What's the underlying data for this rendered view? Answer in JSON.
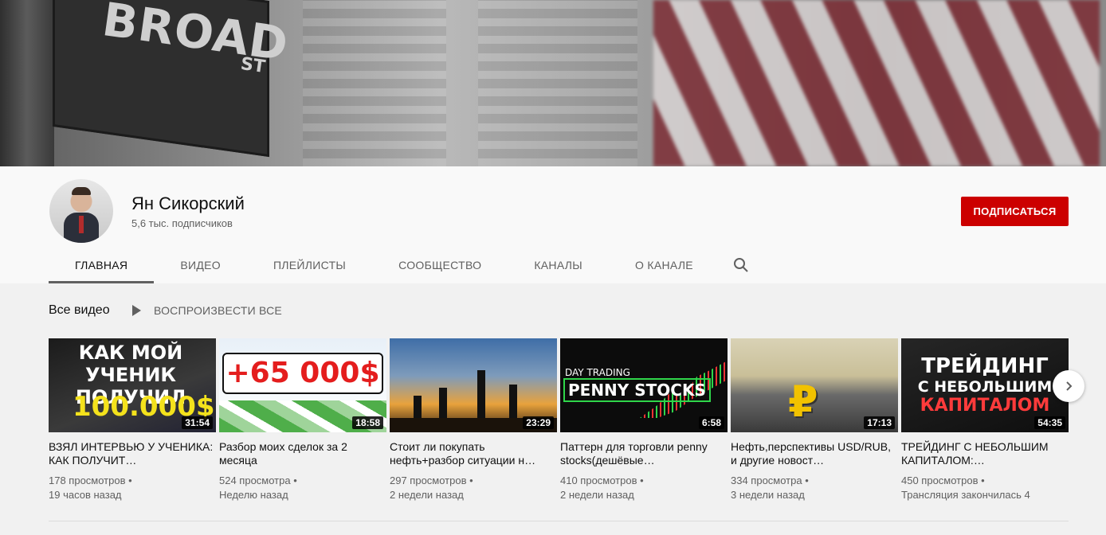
{
  "banner": {
    "sign_text": "BROAD",
    "sign_suffix": "ST"
  },
  "channel": {
    "name": "Ян Сикорский",
    "subscribers": "5,6 тыс. подписчиков",
    "subscribe_label": "ПОДПИСАТЬСЯ"
  },
  "tabs": [
    {
      "label": "ГЛАВНАЯ",
      "active": true
    },
    {
      "label": "ВИДЕО"
    },
    {
      "label": "ПЛЕЙЛИСТЫ"
    },
    {
      "label": "СООБЩЕСТВО"
    },
    {
      "label": "КАНАЛЫ"
    },
    {
      "label": "О КАНАЛЕ"
    }
  ],
  "section": {
    "title": "Все видео",
    "play_all": "ВОСПРОИЗВЕСТИ ВСЕ"
  },
  "videos": [
    {
      "title": "ВЗЯЛ ИНТЕРВЬЮ У УЧЕНИКА: КАК ПОЛУЧИТ…",
      "views": "178 просмотров •",
      "age": "19 часов назад",
      "duration": "31:54",
      "thumb_text": [
        "КАК МОЙ УЧЕНИК ПОЛУЧИЛ",
        "100.000$"
      ]
    },
    {
      "title": "Разбор моих сделок за 2 месяца",
      "views": "524 просмотра •",
      "age": "Неделю назад",
      "duration": "18:58",
      "thumb_text": [
        "+65 000$"
      ]
    },
    {
      "title": "Стоит ли покупать нефть+разбор ситуации н…",
      "views": "297 просмотров •",
      "age": "2 недели назад",
      "duration": "23:29",
      "thumb_text": []
    },
    {
      "title": "Паттерн для торговли penny stocks(дешёвые…",
      "views": "410 просмотров •",
      "age": "2 недели назад",
      "duration": "6:58",
      "thumb_text": [
        "DAY TRADING",
        "PENNY STOCKS"
      ]
    },
    {
      "title": "Нефть,перспективы USD/RUB, и другие новост…",
      "views": "334 просмотра •",
      "age": "3 недели назад",
      "duration": "17:13",
      "thumb_text": [
        "₽"
      ]
    },
    {
      "title": "ТРЕЙДИНГ С НЕБОЛЬШИМ КАПИТАЛОМ:…",
      "views": "450 просмотров •",
      "age": "Трансляция закончилась 4",
      "duration": "54:35",
      "thumb_text": [
        "ТРЕЙДИНГ",
        "С НЕБОЛЬШИМ",
        "КАПИТАЛОМ"
      ]
    }
  ],
  "colors": {
    "subscribe": "#cc0000",
    "background": "#f1f1f1",
    "header": "#f9f9f9"
  },
  "icons": [
    "search-icon",
    "play-icon",
    "chevron-right-icon"
  ]
}
